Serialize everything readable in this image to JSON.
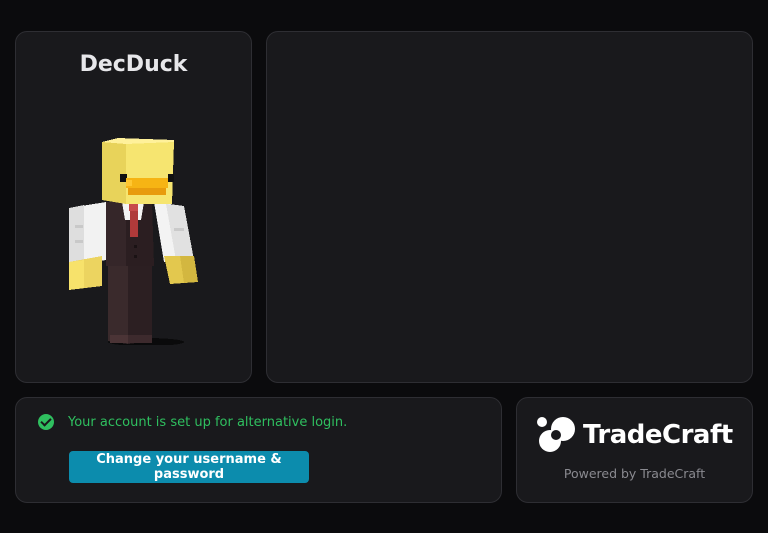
{
  "profile": {
    "username": "DecDuck"
  },
  "account": {
    "status_text": "Your account is set up for alternative login.",
    "change_button_label": "Change your username & password"
  },
  "brand": {
    "name": "TradeCraft",
    "powered_by": "Powered by TradeCraft"
  },
  "colors": {
    "success": "#2fbf5f",
    "button": "#0c8cad",
    "panel": "#19191c",
    "background": "#0b0b0d"
  },
  "icons": {
    "status": "check-circle-icon",
    "brand": "tradecraft-logo-icon"
  }
}
